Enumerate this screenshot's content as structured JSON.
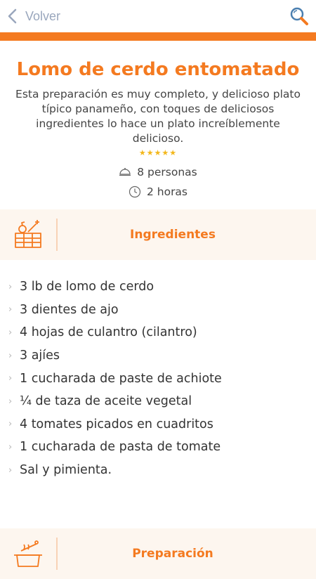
{
  "header": {
    "back_label": "Volver",
    "back_icon": "chevron-left-icon",
    "search_icon": "search-icon",
    "accent_color": "#f47a20"
  },
  "recipe": {
    "title": "Lomo de cerdo entomatado",
    "description": "Esta preparación es muy completo, y delicioso plato típico panameño, con toques de deliciosos ingredientes lo hace un plato increíblemente delicioso.",
    "rating": 5,
    "stars": "★★★★★",
    "servings": "8 personas",
    "time": "2 horas"
  },
  "ingredients_section": {
    "title": "Ingredientes",
    "items": [
      "3 lb de lomo de cerdo",
      "3 dientes de ajo",
      "4 hojas de culantro (cilantro)",
      "3 ajíes",
      "1 cucharada de paste de achiote",
      "¼ de taza de aceite vegetal",
      "4 tomates picados en cuadritos",
      "1 cucharada de pasta de tomate",
      "Sal y pimienta."
    ]
  },
  "preparation_section": {
    "title": "Preparación"
  }
}
